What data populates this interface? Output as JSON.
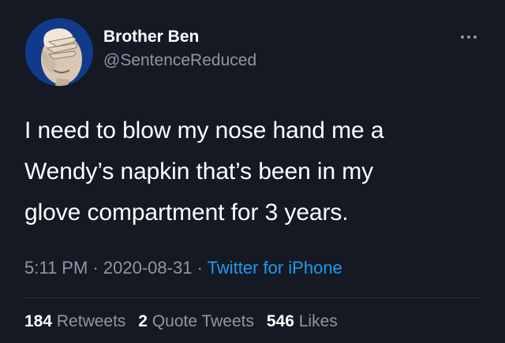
{
  "author": {
    "display_name": "Brother Ben",
    "handle": "@SentenceReduced",
    "avatar_icon": "facepalm-avatar"
  },
  "more_icon": "more-icon",
  "tweet": {
    "text_lines": [
      "I need to blow my nose hand me a",
      "Wendy’s napkin that’s been in my",
      "glove compartment for 3 years."
    ],
    "time": "5:11 PM",
    "date": "2020-08-31",
    "separator": "·",
    "source": "Twitter for iPhone"
  },
  "stats": {
    "retweets_count": "184",
    "retweets_label": "Retweets",
    "quote_tweets_count": "2",
    "quote_tweets_label": "Quote Tweets",
    "likes_count": "546",
    "likes_label": "Likes"
  },
  "colors": {
    "background": "#141923",
    "link": "#1d9bf0",
    "secondary_text": "#8f98a3"
  }
}
